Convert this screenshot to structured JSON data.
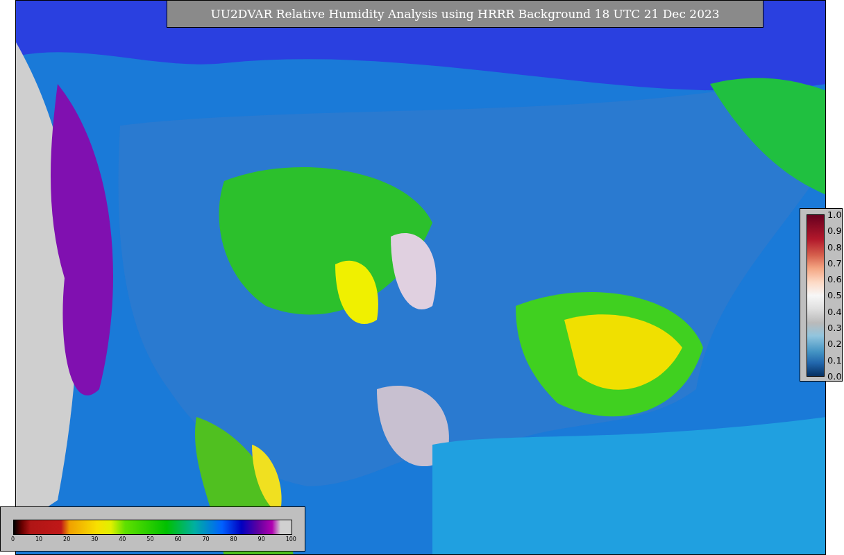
{
  "title": "UU2DVAR Relative Humidity Analysis using HRRR Background 18 UTC 21 Dec 2023",
  "weight_legend": {
    "ticks": [
      "1.0",
      "0.9",
      "0.8",
      "0.7",
      "0.6",
      "0.5",
      "0.4",
      "0.3",
      "0.2",
      "0.1",
      "0.0"
    ]
  },
  "humidity_legend": {
    "ticks": [
      "0",
      "10",
      "20",
      "30",
      "40",
      "50",
      "60",
      "70",
      "80",
      "90",
      "100"
    ]
  }
}
